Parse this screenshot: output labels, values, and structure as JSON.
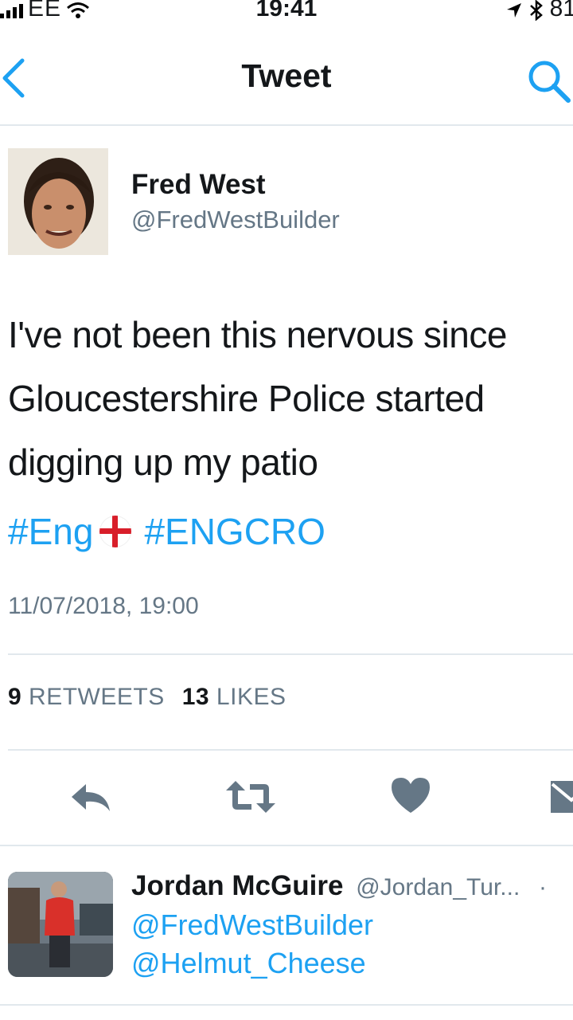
{
  "status_bar": {
    "carrier": "EE",
    "time": "19:41",
    "battery": "81"
  },
  "nav": {
    "title": "Tweet"
  },
  "tweet": {
    "author_name": "Fred West",
    "author_handle": "@FredWestBuilder",
    "text": "I've not been this nervous since Gloucestershire Police started digging up my patio",
    "hashtags": [
      "#Eng",
      "#ENGCRO"
    ],
    "timestamp": "11/07/2018, 19:00",
    "retweets_count": "9",
    "retweets_label": "RETWEETS",
    "likes_count": "13",
    "likes_label": "LIKES"
  },
  "reply": {
    "author_name": "Jordan McGuire",
    "author_handle": "@Jordan_Tur...",
    "separator": "·",
    "mentions": [
      "@FredWestBuilder",
      "@Helmut_Cheese"
    ]
  },
  "colors": {
    "accent": "#1da1f2",
    "secondary_text": "#657786",
    "divider": "#e1e8ed",
    "icon_gray": "#657786"
  },
  "icons": {
    "back": "chevron-left-icon",
    "search": "search-icon",
    "reply": "reply-icon",
    "retweet": "retweet-icon",
    "like": "heart-icon",
    "dm": "envelope-icon"
  }
}
